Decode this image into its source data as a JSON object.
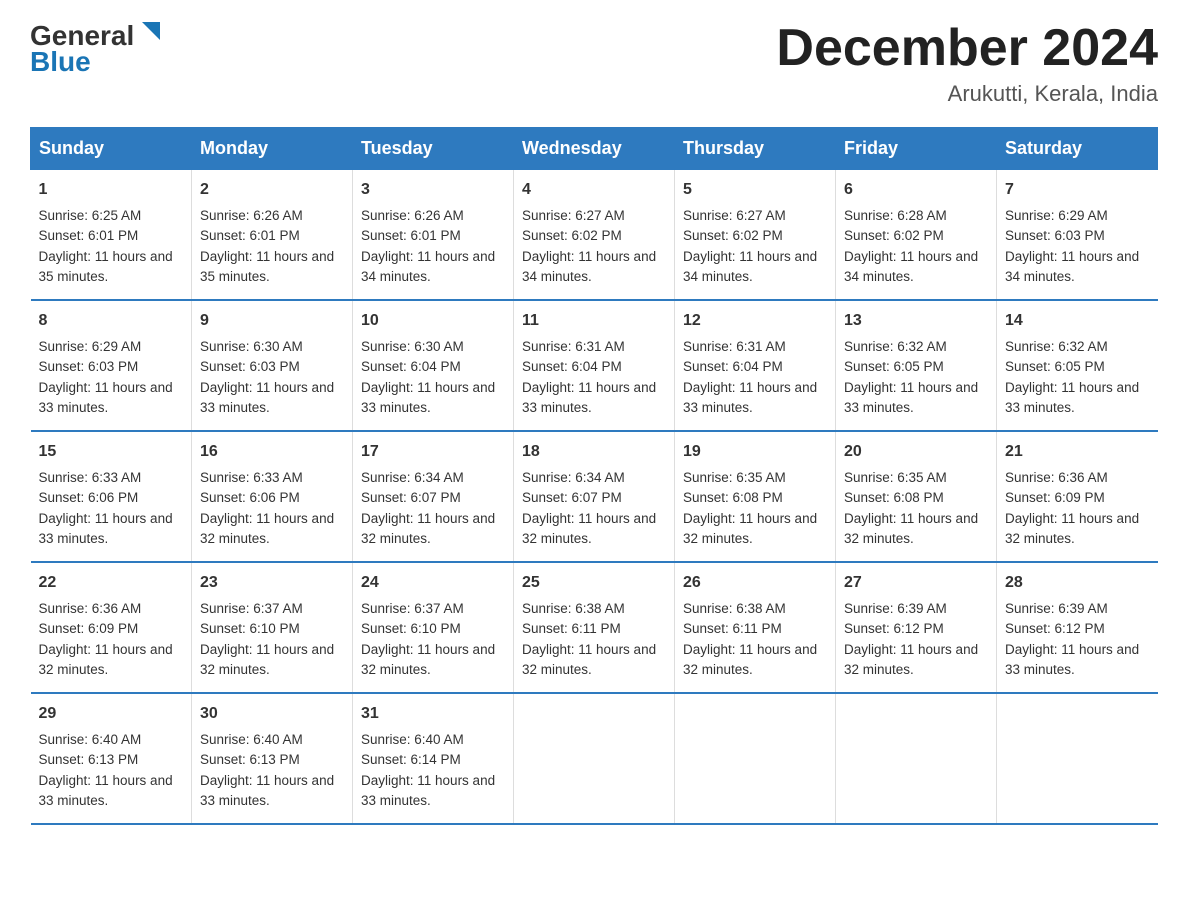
{
  "header": {
    "logo_general": "General",
    "logo_blue": "Blue",
    "main_title": "December 2024",
    "subtitle": "Arukutti, Kerala, India"
  },
  "columns": [
    "Sunday",
    "Monday",
    "Tuesday",
    "Wednesday",
    "Thursday",
    "Friday",
    "Saturday"
  ],
  "weeks": [
    [
      {
        "day": "1",
        "sunrise": "Sunrise: 6:25 AM",
        "sunset": "Sunset: 6:01 PM",
        "daylight": "Daylight: 11 hours and 35 minutes."
      },
      {
        "day": "2",
        "sunrise": "Sunrise: 6:26 AM",
        "sunset": "Sunset: 6:01 PM",
        "daylight": "Daylight: 11 hours and 35 minutes."
      },
      {
        "day": "3",
        "sunrise": "Sunrise: 6:26 AM",
        "sunset": "Sunset: 6:01 PM",
        "daylight": "Daylight: 11 hours and 34 minutes."
      },
      {
        "day": "4",
        "sunrise": "Sunrise: 6:27 AM",
        "sunset": "Sunset: 6:02 PM",
        "daylight": "Daylight: 11 hours and 34 minutes."
      },
      {
        "day": "5",
        "sunrise": "Sunrise: 6:27 AM",
        "sunset": "Sunset: 6:02 PM",
        "daylight": "Daylight: 11 hours and 34 minutes."
      },
      {
        "day": "6",
        "sunrise": "Sunrise: 6:28 AM",
        "sunset": "Sunset: 6:02 PM",
        "daylight": "Daylight: 11 hours and 34 minutes."
      },
      {
        "day": "7",
        "sunrise": "Sunrise: 6:29 AM",
        "sunset": "Sunset: 6:03 PM",
        "daylight": "Daylight: 11 hours and 34 minutes."
      }
    ],
    [
      {
        "day": "8",
        "sunrise": "Sunrise: 6:29 AM",
        "sunset": "Sunset: 6:03 PM",
        "daylight": "Daylight: 11 hours and 33 minutes."
      },
      {
        "day": "9",
        "sunrise": "Sunrise: 6:30 AM",
        "sunset": "Sunset: 6:03 PM",
        "daylight": "Daylight: 11 hours and 33 minutes."
      },
      {
        "day": "10",
        "sunrise": "Sunrise: 6:30 AM",
        "sunset": "Sunset: 6:04 PM",
        "daylight": "Daylight: 11 hours and 33 minutes."
      },
      {
        "day": "11",
        "sunrise": "Sunrise: 6:31 AM",
        "sunset": "Sunset: 6:04 PM",
        "daylight": "Daylight: 11 hours and 33 minutes."
      },
      {
        "day": "12",
        "sunrise": "Sunrise: 6:31 AM",
        "sunset": "Sunset: 6:04 PM",
        "daylight": "Daylight: 11 hours and 33 minutes."
      },
      {
        "day": "13",
        "sunrise": "Sunrise: 6:32 AM",
        "sunset": "Sunset: 6:05 PM",
        "daylight": "Daylight: 11 hours and 33 minutes."
      },
      {
        "day": "14",
        "sunrise": "Sunrise: 6:32 AM",
        "sunset": "Sunset: 6:05 PM",
        "daylight": "Daylight: 11 hours and 33 minutes."
      }
    ],
    [
      {
        "day": "15",
        "sunrise": "Sunrise: 6:33 AM",
        "sunset": "Sunset: 6:06 PM",
        "daylight": "Daylight: 11 hours and 33 minutes."
      },
      {
        "day": "16",
        "sunrise": "Sunrise: 6:33 AM",
        "sunset": "Sunset: 6:06 PM",
        "daylight": "Daylight: 11 hours and 32 minutes."
      },
      {
        "day": "17",
        "sunrise": "Sunrise: 6:34 AM",
        "sunset": "Sunset: 6:07 PM",
        "daylight": "Daylight: 11 hours and 32 minutes."
      },
      {
        "day": "18",
        "sunrise": "Sunrise: 6:34 AM",
        "sunset": "Sunset: 6:07 PM",
        "daylight": "Daylight: 11 hours and 32 minutes."
      },
      {
        "day": "19",
        "sunrise": "Sunrise: 6:35 AM",
        "sunset": "Sunset: 6:08 PM",
        "daylight": "Daylight: 11 hours and 32 minutes."
      },
      {
        "day": "20",
        "sunrise": "Sunrise: 6:35 AM",
        "sunset": "Sunset: 6:08 PM",
        "daylight": "Daylight: 11 hours and 32 minutes."
      },
      {
        "day": "21",
        "sunrise": "Sunrise: 6:36 AM",
        "sunset": "Sunset: 6:09 PM",
        "daylight": "Daylight: 11 hours and 32 minutes."
      }
    ],
    [
      {
        "day": "22",
        "sunrise": "Sunrise: 6:36 AM",
        "sunset": "Sunset: 6:09 PM",
        "daylight": "Daylight: 11 hours and 32 minutes."
      },
      {
        "day": "23",
        "sunrise": "Sunrise: 6:37 AM",
        "sunset": "Sunset: 6:10 PM",
        "daylight": "Daylight: 11 hours and 32 minutes."
      },
      {
        "day": "24",
        "sunrise": "Sunrise: 6:37 AM",
        "sunset": "Sunset: 6:10 PM",
        "daylight": "Daylight: 11 hours and 32 minutes."
      },
      {
        "day": "25",
        "sunrise": "Sunrise: 6:38 AM",
        "sunset": "Sunset: 6:11 PM",
        "daylight": "Daylight: 11 hours and 32 minutes."
      },
      {
        "day": "26",
        "sunrise": "Sunrise: 6:38 AM",
        "sunset": "Sunset: 6:11 PM",
        "daylight": "Daylight: 11 hours and 32 minutes."
      },
      {
        "day": "27",
        "sunrise": "Sunrise: 6:39 AM",
        "sunset": "Sunset: 6:12 PM",
        "daylight": "Daylight: 11 hours and 32 minutes."
      },
      {
        "day": "28",
        "sunrise": "Sunrise: 6:39 AM",
        "sunset": "Sunset: 6:12 PM",
        "daylight": "Daylight: 11 hours and 33 minutes."
      }
    ],
    [
      {
        "day": "29",
        "sunrise": "Sunrise: 6:40 AM",
        "sunset": "Sunset: 6:13 PM",
        "daylight": "Daylight: 11 hours and 33 minutes."
      },
      {
        "day": "30",
        "sunrise": "Sunrise: 6:40 AM",
        "sunset": "Sunset: 6:13 PM",
        "daylight": "Daylight: 11 hours and 33 minutes."
      },
      {
        "day": "31",
        "sunrise": "Sunrise: 6:40 AM",
        "sunset": "Sunset: 6:14 PM",
        "daylight": "Daylight: 11 hours and 33 minutes."
      },
      null,
      null,
      null,
      null
    ]
  ]
}
